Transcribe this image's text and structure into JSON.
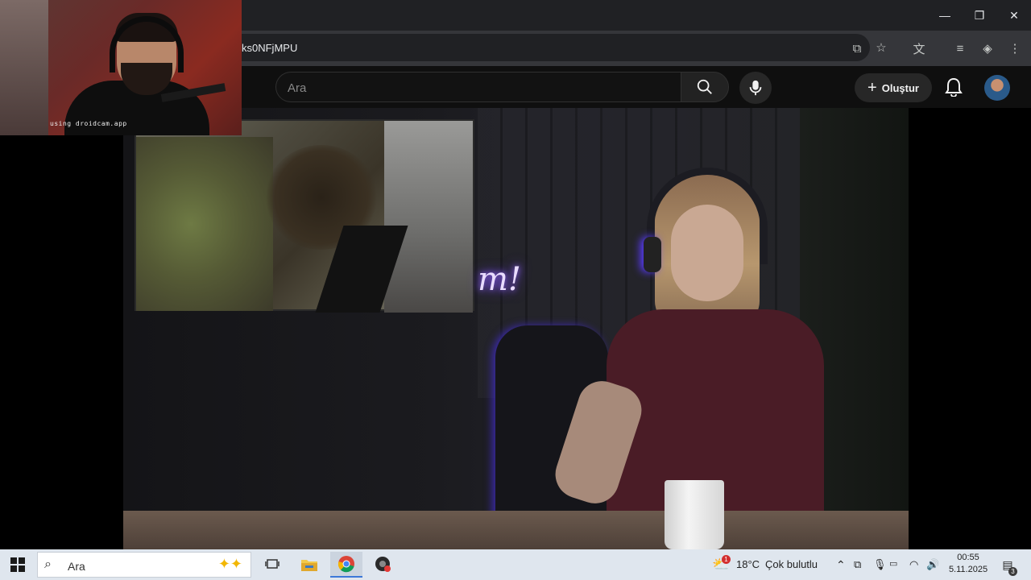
{
  "browser": {
    "url_fragment": "ks0NFjMPU",
    "controls": {
      "minimize": "—",
      "restore": "❐",
      "close": "✕"
    }
  },
  "youtube": {
    "search_placeholder": "Ara",
    "create_label": "Oluştur",
    "brand_color": "#0f0f0f"
  },
  "video": {
    "neon_sign": "m!"
  },
  "webcam": {
    "watermark": "using droidcam.app"
  },
  "taskbar": {
    "search_placeholder": "Ara",
    "weather_temp": "18°C",
    "weather_desc": "Çok bulutlu",
    "weather_badge": "1",
    "time": "00:55",
    "date": "5.11.2025",
    "notification_count": "3"
  }
}
